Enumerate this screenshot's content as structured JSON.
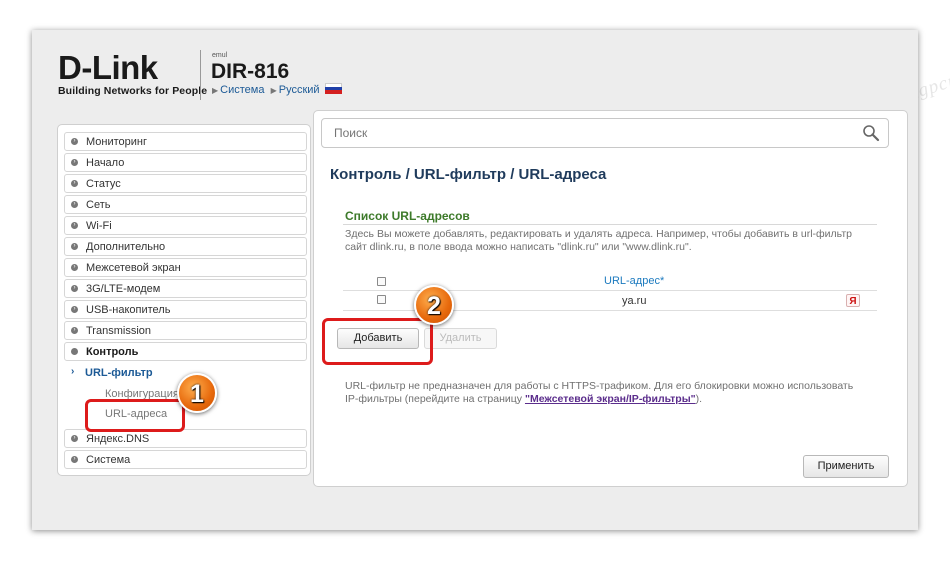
{
  "header": {
    "logo_text": "D-Link",
    "logo_tagline": "Building Networks for People",
    "emul_label": "emul",
    "model": "DIR-816",
    "link_system": "Система",
    "link_language": "Русский"
  },
  "sidebar": {
    "items": [
      {
        "label": "Мониторинг"
      },
      {
        "label": "Начало"
      },
      {
        "label": "Статус"
      },
      {
        "label": "Сеть"
      },
      {
        "label": "Wi-Fi"
      },
      {
        "label": "Дополнительно"
      },
      {
        "label": "Межсетевой экран"
      },
      {
        "label": "3G/LTE-модем"
      },
      {
        "label": "USB-накопитель"
      },
      {
        "label": "Transmission"
      },
      {
        "label": "Контроль"
      },
      {
        "label": "Яндекс.DNS"
      },
      {
        "label": "Система"
      }
    ],
    "sub_url_filter": "URL-фильтр",
    "sub_configuration": "Конфигурация",
    "sub_url_addresses": "URL-адреса"
  },
  "search": {
    "placeholder": "Поиск"
  },
  "main": {
    "breadcrumb": "Контроль /  URL-фильтр /  URL-адреса",
    "section_title": "Список URL-адресов",
    "description": "Здесь Вы можете добавлять, редактировать и удалять адреса. Например, чтобы добавить в url-фильтр сайт dlink.ru, в поле ввода можно написать \"dlink.ru\" или \"www.dlink.ru\".",
    "table": {
      "column_header": "URL-адрес*",
      "rows": [
        {
          "url": "ya.ru",
          "icon": "yandex-icon",
          "icon_glyph": "Я"
        }
      ]
    },
    "add_button": "Добавить",
    "delete_button": "Удалить",
    "note_text": "URL-фильтр не предназначен для работы с HTTPS-трафиком. Для его блокировки можно использовать IP-фильтры (перейдите на страницу ",
    "note_link": "\"Межсетевой экран/IP-фильтры\"",
    "note_end": ").",
    "apply_button": "Применить"
  },
  "annotations": {
    "badge1": "1",
    "badge2": "2",
    "color": "#dd1b1b"
  },
  "watermark": "Sovingpcrepair.com"
}
